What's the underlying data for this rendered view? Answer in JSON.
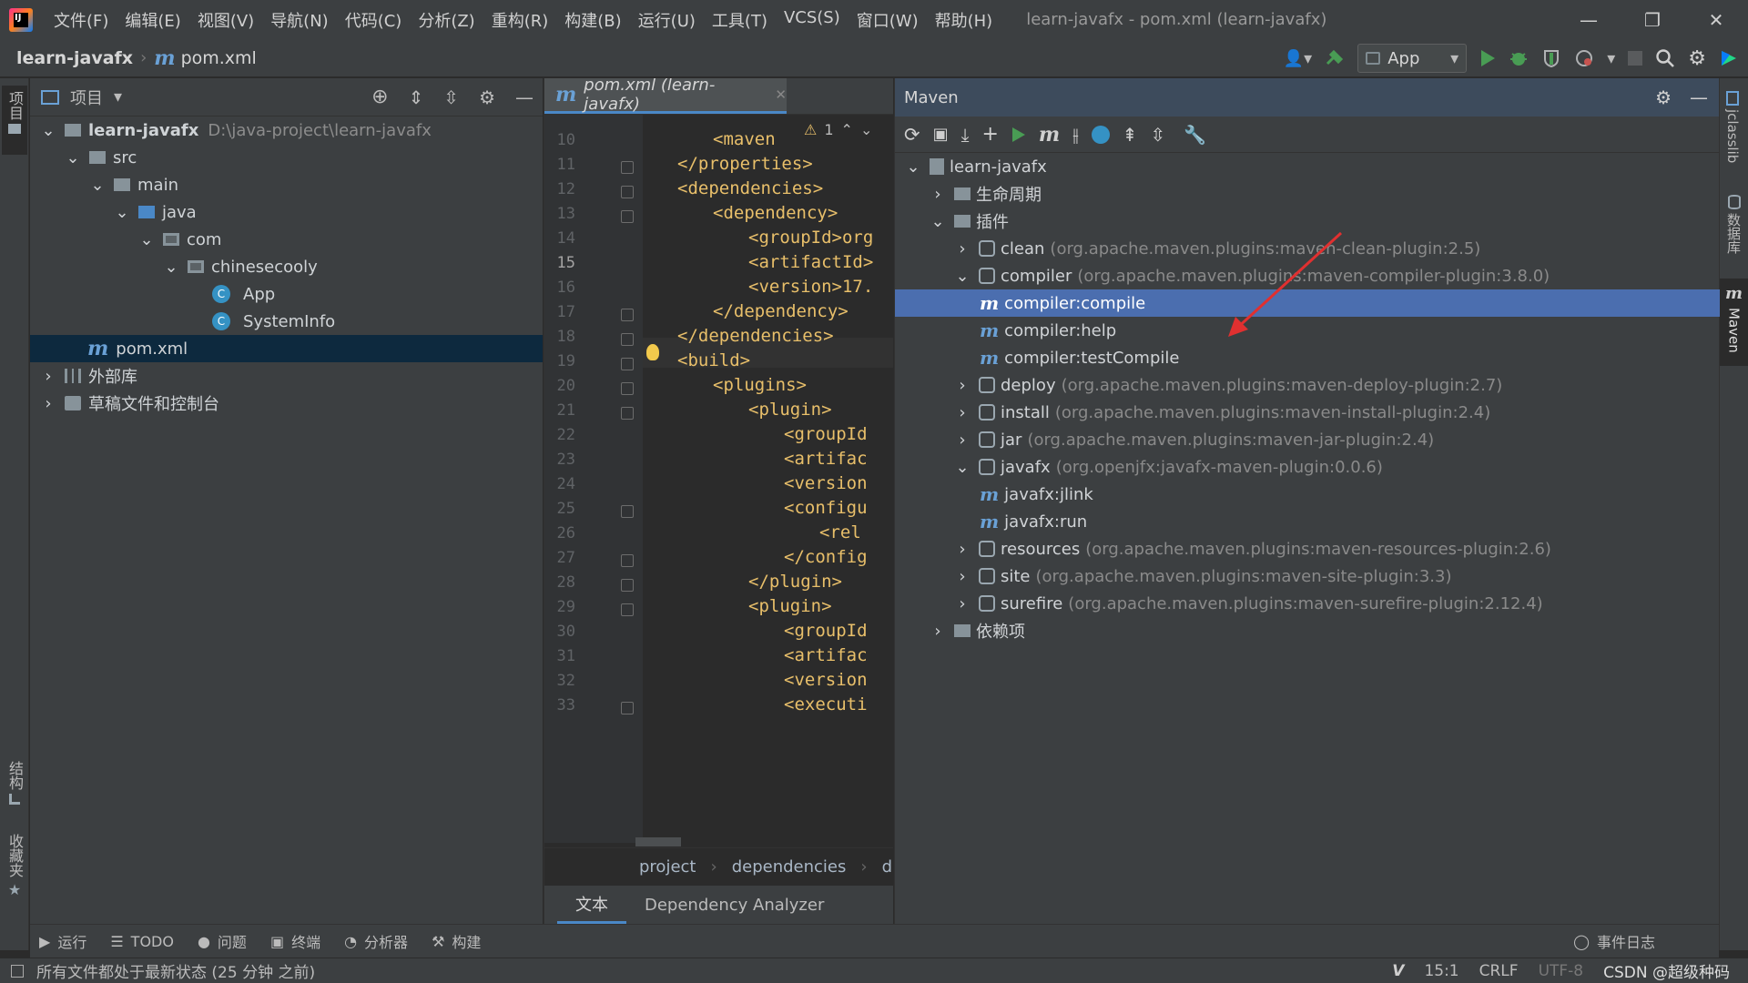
{
  "menu": [
    "文件(F)",
    "编辑(E)",
    "视图(V)",
    "导航(N)",
    "代码(C)",
    "分析(Z)",
    "重构(R)",
    "构建(B)",
    "运行(U)",
    "工具(T)",
    "VCS(S)",
    "窗口(W)",
    "帮助(H)"
  ],
  "window_title": "learn-javafx - pom.xml (learn-javafx)",
  "breadcrumb": {
    "project": "learn-javafx",
    "file": "pom.xml"
  },
  "run_config": "App",
  "left_stripe": {
    "project": "项目",
    "structure": "结构",
    "favorites": "收藏夹"
  },
  "right_stripe": {
    "jclasslib": "jclasslib",
    "database": "数据库",
    "maven": "Maven"
  },
  "project_panel": {
    "title": "项目",
    "tree": [
      {
        "label": "learn-javafx",
        "path": "D:\\java-project\\learn-javafx"
      },
      {
        "label": "src"
      },
      {
        "label": "main"
      },
      {
        "label": "java"
      },
      {
        "label": "com"
      },
      {
        "label": "chinesecooly"
      },
      {
        "label": "App"
      },
      {
        "label": "SystemInfo"
      },
      {
        "label": "pom.xml"
      },
      {
        "label": "外部库"
      },
      {
        "label": "草稿文件和控制台"
      }
    ]
  },
  "editor": {
    "tab": "pom.xml (learn-javafx)",
    "warning_count": "1",
    "lines": [
      {
        "n": "10",
        "text": "<maven"
      },
      {
        "n": "11",
        "text": "</properties>"
      },
      {
        "n": "12",
        "text": "<dependencies>"
      },
      {
        "n": "13",
        "text": "<dependency>"
      },
      {
        "n": "14",
        "text": "<groupId>org"
      },
      {
        "n": "15",
        "text": "<artifactId>"
      },
      {
        "n": "16",
        "text": "<version>17."
      },
      {
        "n": "17",
        "text": "</dependency>"
      },
      {
        "n": "18",
        "text": "</dependencies>"
      },
      {
        "n": "19",
        "text": "<build>"
      },
      {
        "n": "20",
        "text": "<plugins>"
      },
      {
        "n": "21",
        "text": "<plugin>"
      },
      {
        "n": "22",
        "text": "<groupId"
      },
      {
        "n": "23",
        "text": "<artifac"
      },
      {
        "n": "24",
        "text": "<version"
      },
      {
        "n": "25",
        "text": "<configu"
      },
      {
        "n": "26",
        "text": "<rel"
      },
      {
        "n": "27",
        "text": "</config"
      },
      {
        "n": "28",
        "text": "</plugin>"
      },
      {
        "n": "29",
        "text": "<plugin>"
      },
      {
        "n": "30",
        "text": "<groupId"
      },
      {
        "n": "31",
        "text": "<artifac"
      },
      {
        "n": "32",
        "text": "<version"
      },
      {
        "n": "33",
        "text": "<executi"
      }
    ],
    "breadcrumb": [
      "project",
      "dependencies",
      "dep"
    ],
    "bottom_tabs": [
      "文本",
      "Dependency Analyzer"
    ]
  },
  "maven": {
    "title": "Maven",
    "tree": [
      {
        "label": "learn-javafx",
        "detail": ""
      },
      {
        "label": "生命周期",
        "detail": ""
      },
      {
        "label": "插件",
        "detail": ""
      },
      {
        "label": "clean",
        "detail": "(org.apache.maven.plugins:maven-clean-plugin:2.5)"
      },
      {
        "label": "compiler",
        "detail": "(org.apache.maven.plugins:maven-compiler-plugin:3.8.0)"
      },
      {
        "label": "compiler:compile",
        "detail": ""
      },
      {
        "label": "compiler:help",
        "detail": ""
      },
      {
        "label": "compiler:testCompile",
        "detail": ""
      },
      {
        "label": "deploy",
        "detail": "(org.apache.maven.plugins:maven-deploy-plugin:2.7)"
      },
      {
        "label": "install",
        "detail": "(org.apache.maven.plugins:maven-install-plugin:2.4)"
      },
      {
        "label": "jar",
        "detail": "(org.apache.maven.plugins:maven-jar-plugin:2.4)"
      },
      {
        "label": "javafx",
        "detail": "(org.openjfx:javafx-maven-plugin:0.0.6)"
      },
      {
        "label": "javafx:jlink",
        "detail": ""
      },
      {
        "label": "javafx:run",
        "detail": ""
      },
      {
        "label": "resources",
        "detail": "(org.apache.maven.plugins:maven-resources-plugin:2.6)"
      },
      {
        "label": "site",
        "detail": "(org.apache.maven.plugins:maven-site-plugin:3.3)"
      },
      {
        "label": "surefire",
        "detail": "(org.apache.maven.plugins:maven-surefire-plugin:2.12.4)"
      },
      {
        "label": "依赖项",
        "detail": ""
      }
    ]
  },
  "toolwindows": [
    "运行",
    "TODO",
    "问题",
    "终端",
    "分析器",
    "构建"
  ],
  "event_log": "事件日志",
  "status": {
    "message": "所有文件都处于最新状态 (25 分钟 之前)",
    "position": "15:1",
    "line_sep": "CRLF",
    "encoding": "UTF-8",
    "watermark": "CSDN @超级种码"
  },
  "colors": {
    "selection": "#4b6eaf",
    "accent": "#4a88c7",
    "tag": "#e8bf6a",
    "run_green": "#499c54"
  }
}
